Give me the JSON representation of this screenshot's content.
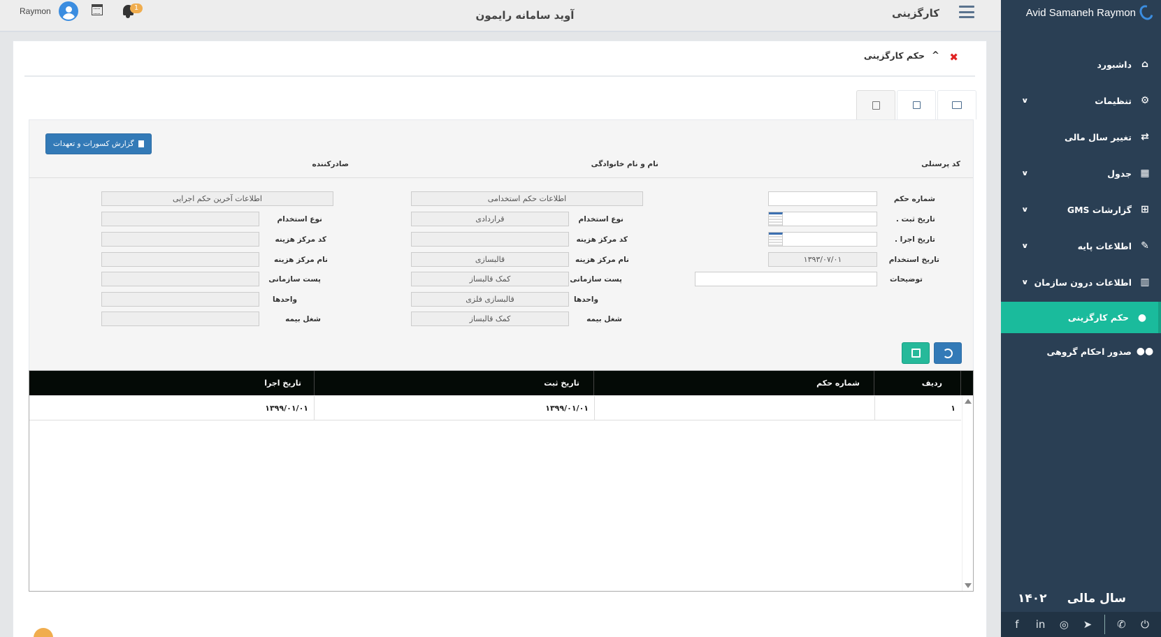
{
  "brand": {
    "name": "Avid Samaneh Raymon"
  },
  "topbar": {
    "section_title": "کارگزینی",
    "system_name": "آوید سامانه رایمون",
    "user_name": "Raymon",
    "notification_count": "1"
  },
  "sidebar": {
    "items": [
      {
        "label": "داشبورد",
        "icon": "home-icon",
        "has_submenu": false
      },
      {
        "label": "تنظیمات",
        "icon": "cogs-icon",
        "has_submenu": true
      },
      {
        "label": "تغییر سال مالی",
        "icon": "retweet-icon",
        "has_submenu": false
      },
      {
        "label": "جدول",
        "icon": "table-icon",
        "has_submenu": true
      },
      {
        "label": "گزارشات GMS",
        "icon": "sitemap-icon",
        "has_submenu": true
      },
      {
        "label": "اطلاعات پایه",
        "icon": "edit-icon",
        "has_submenu": true
      },
      {
        "label": "اطلاعات درون سازمان",
        "icon": "building-icon",
        "has_submenu": true
      },
      {
        "label": "حکم کارگزینی",
        "icon": "user-icon",
        "has_submenu": false,
        "active": true
      },
      {
        "label": "صدور احکام گروهی",
        "icon": "users-icon",
        "has_submenu": false
      }
    ],
    "fiscal_label": "سال مالی",
    "fiscal_year": "۱۴۰۲",
    "active_color": "#1abb9c",
    "background_color": "#2a3f54"
  },
  "social_icons": [
    "facebook-icon",
    "linkedin-icon",
    "instagram-icon",
    "telegram-icon",
    "phone-icon",
    "power-icon"
  ],
  "panel": {
    "title": "حکم کارگزینی",
    "tabs": [
      "list-tab-icon",
      "edit-tab-icon",
      "calculator-tab-icon"
    ]
  },
  "form": {
    "report_button": "گزارش کسورات و تعهدات",
    "header_labels": {
      "personnel_code": "کد پرسنلی",
      "full_name": "نام و نام خانوادگی",
      "issuer": "صادرکننده"
    },
    "right": {
      "decree_number": {
        "label": "شماره حکم",
        "value": ""
      },
      "register_date": {
        "label": "تاریخ ثبت .",
        "value": ""
      },
      "execute_date": {
        "label": "تاریخ اجرا .",
        "value": ""
      },
      "hire_date": {
        "label": "تاریخ استخدام",
        "value": "۱۳۹۳/۰۷/۰۱"
      },
      "description": {
        "label": "توضیحات",
        "value": ""
      }
    },
    "middle": {
      "section_button": "اطلاعات حکم استخدامی",
      "employment_type": {
        "label": "نوع استخدام",
        "value": "قراردادی"
      },
      "cost_center_code": {
        "label": "کد مرکز هزینه",
        "value": ""
      },
      "cost_center_name": {
        "label": "نام مرکز هزینه",
        "value": "قالبسازی"
      },
      "org_post": {
        "label": "پست سازمانی",
        "value": "کمک قالبساز"
      },
      "units": {
        "label": "واحدها",
        "value": "قالبسازی فلزی"
      },
      "insurance_job": {
        "label": "شغل بیمه",
        "value": "کمک قالبساز"
      }
    },
    "left": {
      "section_button": "اطلاعات آخرین حکم اجرایی",
      "employment_type": {
        "label": "نوع استخدام",
        "value": ""
      },
      "cost_center_code": {
        "label": "کد مرکز هزینه",
        "value": ""
      },
      "cost_center_name": {
        "label": "نام مرکز هزینه",
        "value": ""
      },
      "org_post": {
        "label": "پست سازمانی",
        "value": ""
      },
      "units": {
        "label": "واحدها",
        "value": ""
      },
      "insurance_job": {
        "label": "شغل بیمه",
        "value": ""
      }
    }
  },
  "grid": {
    "columns": [
      "ردیف",
      "شماره حکم",
      "تاریخ ثبت",
      "تاریخ اجرا"
    ],
    "rows": [
      {
        "row": "۱",
        "decree_number": "",
        "register_date": "۱۳۹۹/۰۱/۰۱",
        "execute_date": "۱۳۹۹/۰۱/۰۱"
      }
    ]
  }
}
